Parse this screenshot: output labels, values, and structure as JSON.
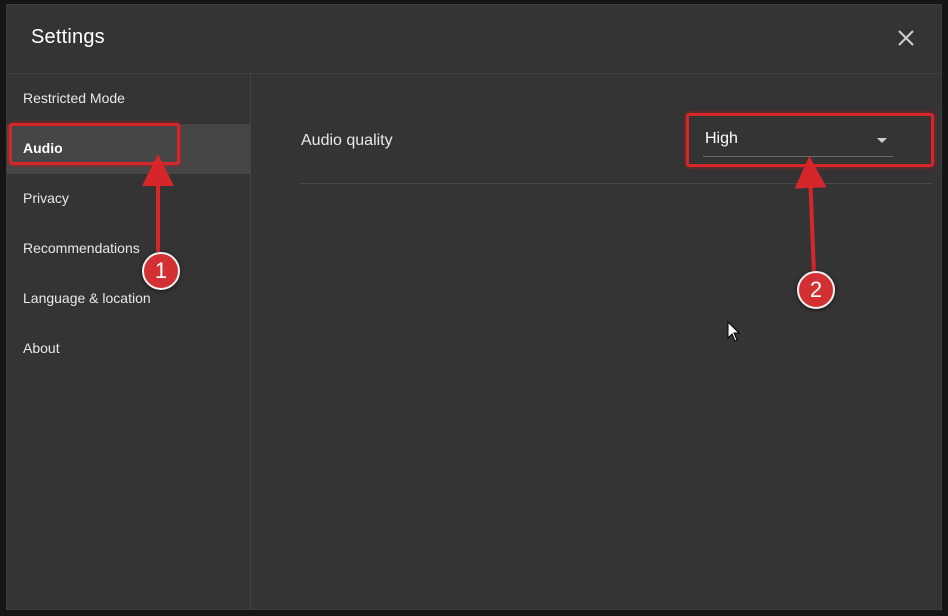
{
  "dialog": {
    "title": "Settings"
  },
  "sidebar": {
    "items": [
      {
        "label": "Restricted Mode"
      },
      {
        "label": "Audio",
        "active": true
      },
      {
        "label": "Privacy"
      },
      {
        "label": "Recommendations"
      },
      {
        "label": "Language & location"
      },
      {
        "label": "About"
      }
    ]
  },
  "main": {
    "audio_quality": {
      "label": "Audio quality",
      "selected_value": "High"
    }
  },
  "annotations": {
    "step1": "1",
    "step2": "2",
    "highlight_color": "#d7262a"
  },
  "icons": [
    "close-icon",
    "dropdown-caret-icon",
    "mouse-cursor-icon"
  ]
}
